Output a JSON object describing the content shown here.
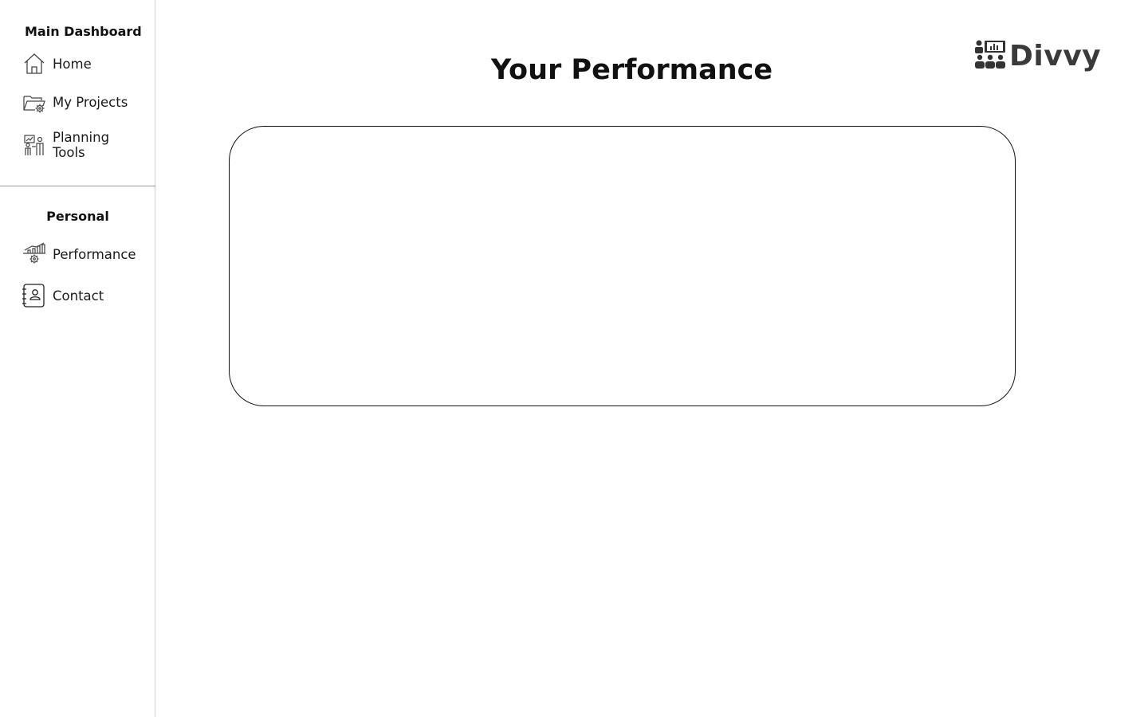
{
  "sidebar": {
    "main_section_title": "Main Dashboard",
    "main_items": [
      {
        "label": "Home",
        "icon": "home-icon"
      },
      {
        "label": "My Projects",
        "icon": "folder-gear-icon"
      },
      {
        "label": "Planning Tools",
        "icon": "planning-tools-icon"
      }
    ],
    "personal_section_title": "Personal",
    "personal_items": [
      {
        "label": "Performance",
        "icon": "performance-chart-icon"
      },
      {
        "label": "Contact",
        "icon": "contact-book-icon"
      }
    ]
  },
  "header": {
    "title": "Your Performance",
    "logo_text": "Divvy",
    "logo_icon": "team-presentation-icon"
  },
  "main": {
    "performance_panel": {}
  }
}
